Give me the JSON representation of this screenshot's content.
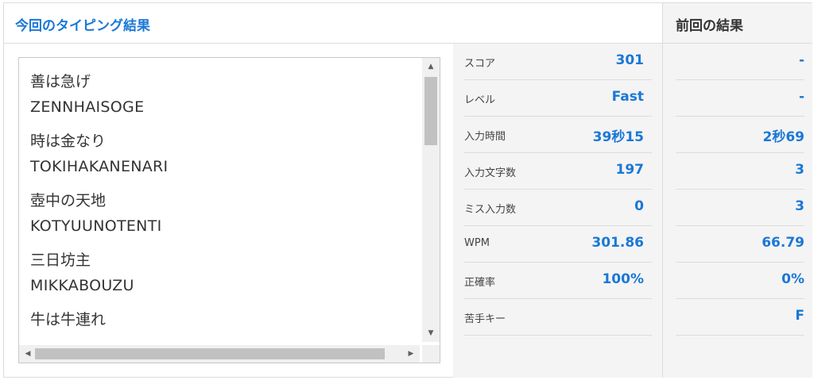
{
  "header": {
    "current_title": "今回のタイピング結果",
    "previous_title": "前回の結果"
  },
  "entries": [
    {
      "jp": "善は急げ",
      "romaji": "ZENNHAISOGE"
    },
    {
      "jp": "時は金なり",
      "romaji": "TOKIHAKANENARI"
    },
    {
      "jp": "壺中の天地",
      "romaji": "KOTYUUNOTENTI"
    },
    {
      "jp": "三日坊主",
      "romaji": "MIKKABOUZU"
    },
    {
      "jp": "牛は牛連れ",
      "romaji": ""
    }
  ],
  "stats": [
    {
      "label": "スコア",
      "value": "301"
    },
    {
      "label": "レベル",
      "value": "Fast"
    },
    {
      "label": "入力時間",
      "value": "39秒15"
    },
    {
      "label": "入力文字数",
      "value": "197"
    },
    {
      "label": "ミス入力数",
      "value": "0"
    },
    {
      "label": "WPM",
      "value": "301.86"
    },
    {
      "label": "正確率",
      "value": "100%"
    },
    {
      "label": "苦手キー",
      "value": ""
    }
  ],
  "previous": [
    {
      "value": "-"
    },
    {
      "value": "-"
    },
    {
      "value": "2秒69"
    },
    {
      "value": "3"
    },
    {
      "value": "3"
    },
    {
      "value": "66.79"
    },
    {
      "value": "0%"
    },
    {
      "value": "F"
    }
  ],
  "scroll": {
    "up_arrow": "▲",
    "down_arrow": "▼",
    "left_arrow": "◀",
    "right_arrow": "▶"
  }
}
